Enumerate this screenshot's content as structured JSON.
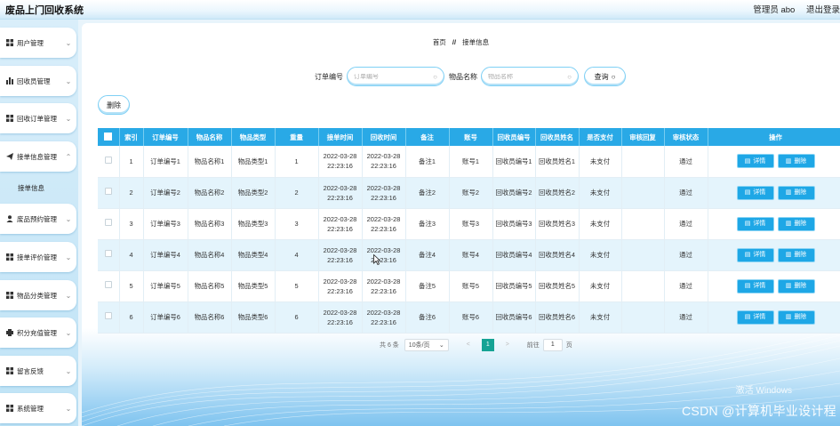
{
  "app": {
    "title": "废品上门回收系统"
  },
  "header": {
    "user_role": "管理员 abo",
    "logout": "退出登录"
  },
  "sidebar": {
    "items": [
      {
        "label": "用户管理",
        "icon": "grid-icon"
      },
      {
        "label": "回收员管理",
        "icon": "bar-chart-icon"
      },
      {
        "label": "回收订单管理",
        "icon": "grid-icon"
      },
      {
        "label": "接单信息管理",
        "icon": "send-icon"
      },
      {
        "label": "废品预约管理",
        "icon": "user-icon"
      },
      {
        "label": "接单评价管理",
        "icon": "grid-icon"
      },
      {
        "label": "物品分类管理",
        "icon": "grid-icon"
      },
      {
        "label": "积分充值管理",
        "icon": "printer-icon"
      },
      {
        "label": "留言反馈",
        "icon": "grid-icon"
      },
      {
        "label": "系统管理",
        "icon": "grid-icon"
      }
    ],
    "sub_item": "接单信息"
  },
  "breadcrumb": {
    "home": "首页",
    "separator": "//",
    "current": "接单信息"
  },
  "search": {
    "order_label": "订单编号",
    "order_placeholder": "订单编号",
    "item_label": "物品名称",
    "item_placeholder": "物品名称",
    "query_button": "查询"
  },
  "toolbar": {
    "delete_label": "删除"
  },
  "table": {
    "columns": [
      "索引",
      "订单编号",
      "物品名称",
      "物品类型",
      "重量",
      "接单时间",
      "回收时间",
      "备注",
      "账号",
      "回收员编号",
      "回收员姓名",
      "是否支付",
      "审核回复",
      "审核状态",
      "操作"
    ],
    "rows": [
      {
        "index": "1",
        "order": "订单编号1",
        "name": "物品名称1",
        "type": "物品类型1",
        "weight": "1",
        "accept_time": "2022-03-28 22:23:16",
        "recycle_time": "2022-03-28 22:23:16",
        "note": "备注1",
        "account": "账号1",
        "collector_no": "回收员编号1",
        "collector_name": "回收员姓名1",
        "paid": "未支付",
        "reply": "",
        "status": "通过"
      },
      {
        "index": "2",
        "order": "订单编号2",
        "name": "物品名称2",
        "type": "物品类型2",
        "weight": "2",
        "accept_time": "2022-03-28 22:23:16",
        "recycle_time": "2022-03-28 22:23:16",
        "note": "备注2",
        "account": "账号2",
        "collector_no": "回收员编号2",
        "collector_name": "回收员姓名2",
        "paid": "未支付",
        "reply": "",
        "status": "通过"
      },
      {
        "index": "3",
        "order": "订单编号3",
        "name": "物品名称3",
        "type": "物品类型3",
        "weight": "3",
        "accept_time": "2022-03-28 22:23:16",
        "recycle_time": "2022-03-28 22:23:16",
        "note": "备注3",
        "account": "账号3",
        "collector_no": "回收员编号3",
        "collector_name": "回收员姓名3",
        "paid": "未支付",
        "reply": "",
        "status": "通过"
      },
      {
        "index": "4",
        "order": "订单编号4",
        "name": "物品名称4",
        "type": "物品类型4",
        "weight": "4",
        "accept_time": "2022-03-28 22:23:16",
        "recycle_time": "2022-03-28 22:23:16",
        "note": "备注4",
        "account": "账号4",
        "collector_no": "回收员编号4",
        "collector_name": "回收员姓名4",
        "paid": "未支付",
        "reply": "",
        "status": "通过"
      },
      {
        "index": "5",
        "order": "订单编号5",
        "name": "物品名称5",
        "type": "物品类型5",
        "weight": "5",
        "accept_time": "2022-03-28 22:23:16",
        "recycle_time": "2022-03-28 22:23:16",
        "note": "备注5",
        "account": "账号5",
        "collector_no": "回收员编号5",
        "collector_name": "回收员姓名5",
        "paid": "未支付",
        "reply": "",
        "status": "通过"
      },
      {
        "index": "6",
        "order": "订单编号6",
        "name": "物品名称6",
        "type": "物品类型6",
        "weight": "6",
        "accept_time": "2022-03-28 22:23:16",
        "recycle_time": "2022-03-28 22:23:16",
        "note": "备注6",
        "account": "账号6",
        "collector_no": "回收员编号6",
        "collector_name": "回收员姓名6",
        "paid": "未支付",
        "reply": "",
        "status": "通过"
      }
    ],
    "detail_label": "详情",
    "delete_label": "删除"
  },
  "pagination": {
    "total": "共 6 条",
    "page_size": "10条/页",
    "prev": "<",
    "current_page": "1",
    "next": ">",
    "goto_label": "前往",
    "goto_value": "1",
    "goto_unit": "页"
  },
  "overlays": {
    "activate_windows": "激活 Windows",
    "csdn_watermark": "CSDN @计算机毕业设计程"
  },
  "colors": {
    "header_blue": "#29a9e6",
    "row_alt": "#e4f4fc",
    "button_blue": "#1ea7e6",
    "pager_active": "#16a394"
  }
}
